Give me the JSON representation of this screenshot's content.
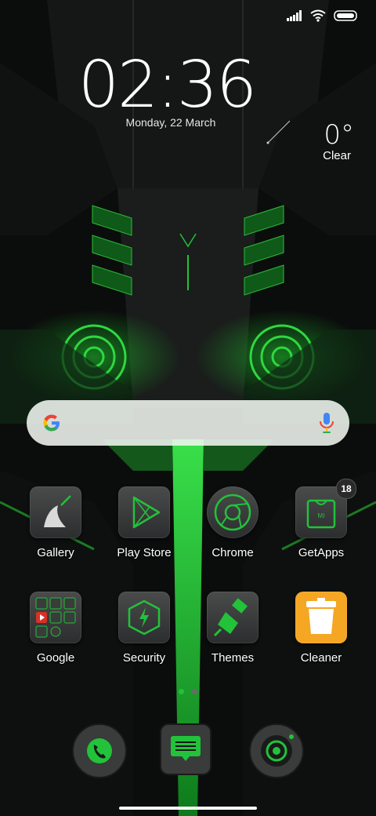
{
  "status_bar": {
    "icons": [
      "signal-icon",
      "wifi-icon",
      "battery-icon"
    ]
  },
  "lock": {
    "time": "02:36",
    "date": "Monday, 22 March"
  },
  "weather": {
    "temperature": "0°",
    "condition": "Clear"
  },
  "search": {
    "google_icon": "google-g-icon",
    "mic_icon": "mic-icon"
  },
  "apps_row1": [
    {
      "label": "Gallery",
      "icon": "gallery-icon"
    },
    {
      "label": "Play Store",
      "icon": "play-store-icon"
    },
    {
      "label": "Chrome",
      "icon": "chrome-icon"
    },
    {
      "label": "GetApps",
      "icon": "getapps-icon",
      "badge": "18"
    }
  ],
  "apps_row2": [
    {
      "label": "Google",
      "icon": "google-folder-icon"
    },
    {
      "label": "Security",
      "icon": "security-icon"
    },
    {
      "label": "Themes",
      "icon": "themes-icon"
    },
    {
      "label": "Cleaner",
      "icon": "cleaner-icon"
    }
  ],
  "page_indicator": {
    "pages": 2,
    "active": 1
  },
  "dock": [
    {
      "icon": "phone-icon"
    },
    {
      "icon": "messages-icon"
    },
    {
      "icon": "camera-icon"
    }
  ],
  "colors": {
    "accent": "#22c23a",
    "background": "#0b0d0c",
    "badge": "#2a2a2a"
  }
}
